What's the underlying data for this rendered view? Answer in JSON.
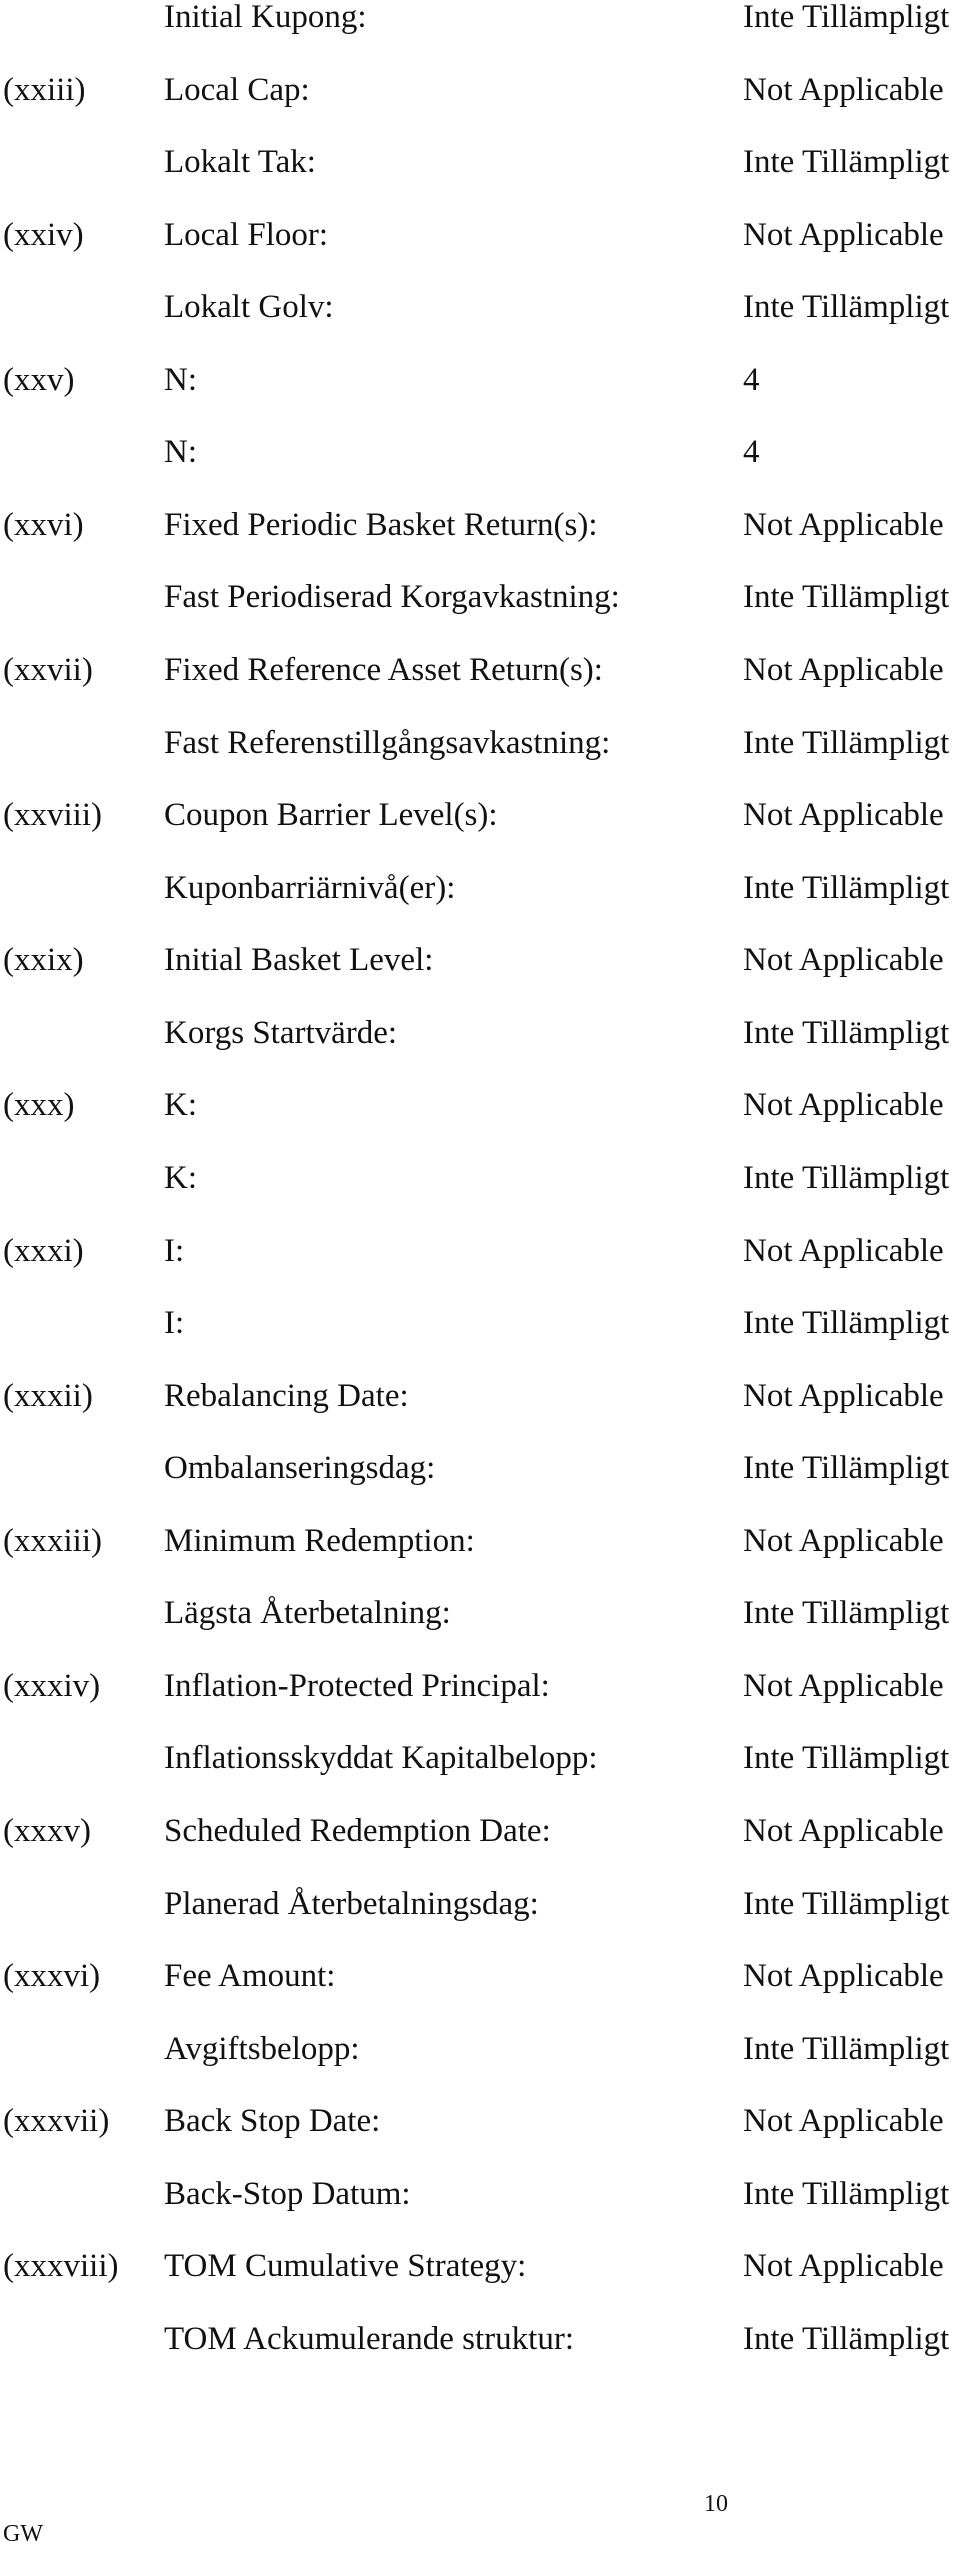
{
  "document": {
    "rows": [
      {
        "num": "",
        "label": "Initial Kupong:",
        "value": "Inte Tillämpligt"
      },
      {
        "num": "(xxiii)",
        "label": "Local Cap:",
        "value": "Not Applicable"
      },
      {
        "num": "",
        "label": "Lokalt Tak:",
        "value": "Inte Tillämpligt"
      },
      {
        "num": "(xxiv)",
        "label": "Local Floor:",
        "value": "Not Applicable"
      },
      {
        "num": "",
        "label": "Lokalt Golv:",
        "value": "Inte Tillämpligt"
      },
      {
        "num": "(xxv)",
        "label": "N:",
        "value": "4"
      },
      {
        "num": "",
        "label": "N:",
        "value": "4"
      },
      {
        "num": "(xxvi)",
        "label": "Fixed Periodic Basket Return(s):",
        "value": "Not Applicable"
      },
      {
        "num": "",
        "label": "Fast Periodiserad Korgavkastning:",
        "value": "Inte Tillämpligt"
      },
      {
        "num": "(xxvii)",
        "label": "Fixed Reference Asset Return(s):",
        "value": "Not Applicable"
      },
      {
        "num": "",
        "label": "Fast Referenstillgångsavkastning:",
        "value": "Inte Tillämpligt"
      },
      {
        "num": "(xxviii)",
        "label": "Coupon Barrier Level(s):",
        "value": "Not Applicable"
      },
      {
        "num": "",
        "label": "Kuponbarriärnivå(er):",
        "value": "Inte Tillämpligt"
      },
      {
        "num": "(xxix)",
        "label": "Initial Basket Level:",
        "value": "Not Applicable"
      },
      {
        "num": "",
        "label": "Korgs Startvärde:",
        "value": "Inte Tillämpligt"
      },
      {
        "num": "(xxx)",
        "label": "K:",
        "value": "Not Applicable"
      },
      {
        "num": "",
        "label": "K:",
        "value": "Inte Tillämpligt"
      },
      {
        "num": "(xxxi)",
        "label": "I:",
        "value": "Not Applicable"
      },
      {
        "num": "",
        "label": "I:",
        "value": "Inte Tillämpligt"
      },
      {
        "num": "(xxxii)",
        "label": "Rebalancing Date:",
        "value": "Not Applicable"
      },
      {
        "num": "",
        "label": "Ombalanseringsdag:",
        "value": "Inte Tillämpligt"
      },
      {
        "num": "(xxxiii)",
        "label": "Minimum Redemption:",
        "value": "Not Applicable"
      },
      {
        "num": "",
        "label": "Lägsta Återbetalning:",
        "value": "Inte Tillämpligt"
      },
      {
        "num": "(xxxiv)",
        "label": "Inflation-Protected Principal:",
        "value": "Not Applicable"
      },
      {
        "num": "",
        "label": "Inflationsskyddat Kapitalbelopp:",
        "value": "Inte Tillämpligt"
      },
      {
        "num": "(xxxv)",
        "label": "Scheduled Redemption Date:",
        "value": "Not Applicable"
      },
      {
        "num": "",
        "label": "Planerad Återbetalningsdag:",
        "value": "Inte Tillämpligt"
      },
      {
        "num": "(xxxvi)",
        "label": "Fee Amount:",
        "value": "Not Applicable"
      },
      {
        "num": "",
        "label": "Avgiftsbelopp:",
        "value": "Inte Tillämpligt"
      },
      {
        "num": "(xxxvii)",
        "label": "Back Stop Date:",
        "value": "Not Applicable"
      },
      {
        "num": "",
        "label": "Back-Stop Datum:",
        "value": "Inte Tillämpligt"
      },
      {
        "num": "(xxxviii)",
        "label": "TOM Cumulative Strategy:",
        "value": "Not Applicable"
      },
      {
        "num": "",
        "label": "TOM Ackumulerande struktur:",
        "value": "Inte Tillämpligt"
      }
    ]
  },
  "footer": {
    "page_number": "10",
    "initials": "GW"
  }
}
